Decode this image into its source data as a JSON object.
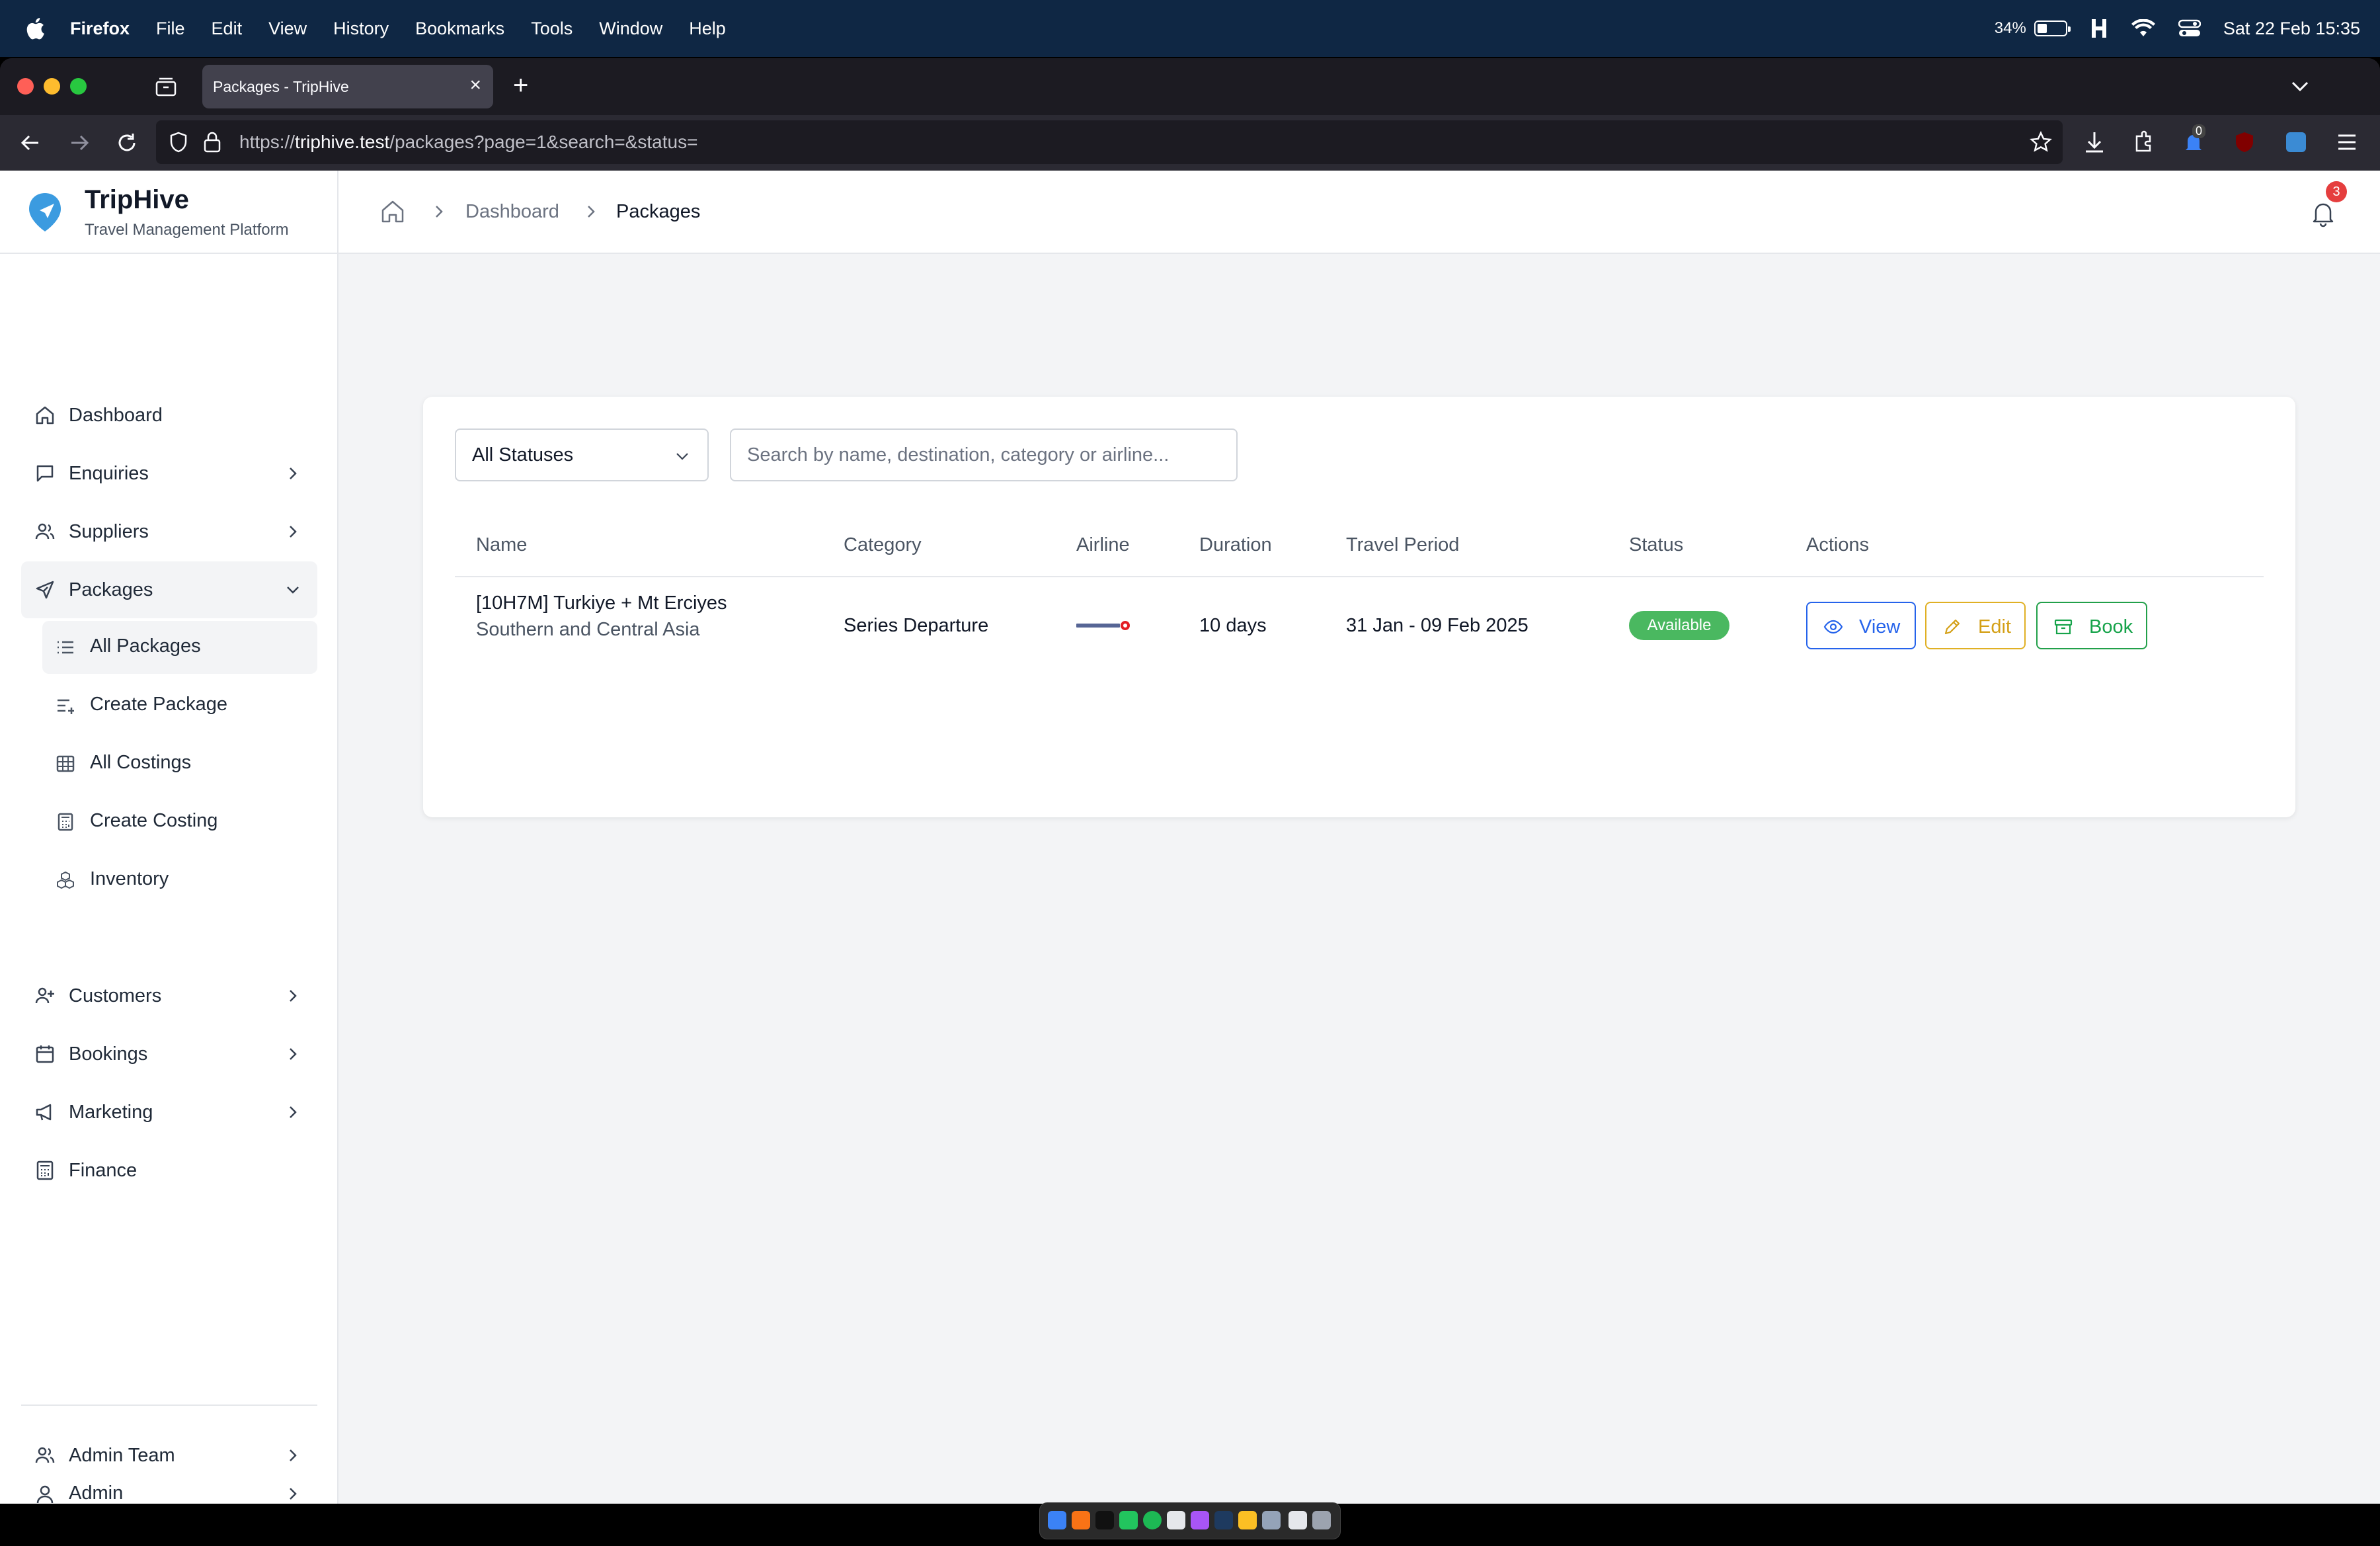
{
  "menubar": {
    "app": "Firefox",
    "items": [
      "File",
      "Edit",
      "View",
      "History",
      "Bookmarks",
      "Tools",
      "Window",
      "Help"
    ],
    "battery": "34%",
    "datetime": "Sat 22 Feb  15:35"
  },
  "browser": {
    "tab_title": "Packages - TripHive",
    "url_scheme": "https://",
    "url_host": "triphive.test",
    "url_path": "/packages?page=1&search=&status=",
    "downloads_count": "0"
  },
  "brand": {
    "name": "TripHive",
    "tagline": "Travel Management Platform",
    "accent": "#3b9be0"
  },
  "sidebar": {
    "items": [
      {
        "label": "Dashboard",
        "icon": "home-icon"
      },
      {
        "label": "Enquiries",
        "icon": "message-icon"
      },
      {
        "label": "Suppliers",
        "icon": "users-icon"
      },
      {
        "label": "Packages",
        "icon": "plane-icon"
      },
      {
        "label": "Customers",
        "icon": "user-plus-icon"
      },
      {
        "label": "Bookings",
        "icon": "calendar-icon"
      },
      {
        "label": "Marketing",
        "icon": "megaphone-icon"
      },
      {
        "label": "Finance",
        "icon": "calculator-icon"
      }
    ],
    "packages_sub": [
      {
        "label": "All Packages",
        "icon": "list-icon"
      },
      {
        "label": "Create Package",
        "icon": "list-plus-icon"
      },
      {
        "label": "All Costings",
        "icon": "grid-icon"
      },
      {
        "label": "Create Costing",
        "icon": "calculator-icon"
      },
      {
        "label": "Inventory",
        "icon": "boxes-icon"
      }
    ],
    "footer": [
      {
        "label": "Admin Team",
        "icon": "users-icon"
      },
      {
        "label": "Admin",
        "icon": "user-icon"
      }
    ]
  },
  "breadcrumb": {
    "dashboard": "Dashboard",
    "current": "Packages"
  },
  "notifications": {
    "count": "3"
  },
  "filters": {
    "status_selected": "All Statuses",
    "search_placeholder": "Search by name, destination, category or airline..."
  },
  "table": {
    "columns": [
      "Name",
      "Category",
      "Airline",
      "Duration",
      "Travel Period",
      "Status",
      "Actions"
    ],
    "rows": [
      {
        "name": "[10H7M] Turkiye + Mt Erciyes",
        "region": "Southern and Central Asia",
        "category": "Series Departure",
        "airline_logo": "turkish-airlines-logo",
        "duration": "10 days",
        "travel_period": "31 Jan - 09 Feb 2025",
        "status": "Available",
        "actions": {
          "view": "View",
          "edit": "Edit",
          "book": "Book"
        }
      }
    ]
  },
  "colors": {
    "status_available": "#4ab860",
    "view": "#2563eb",
    "edit": "#d4a017",
    "book": "#16a34a"
  }
}
